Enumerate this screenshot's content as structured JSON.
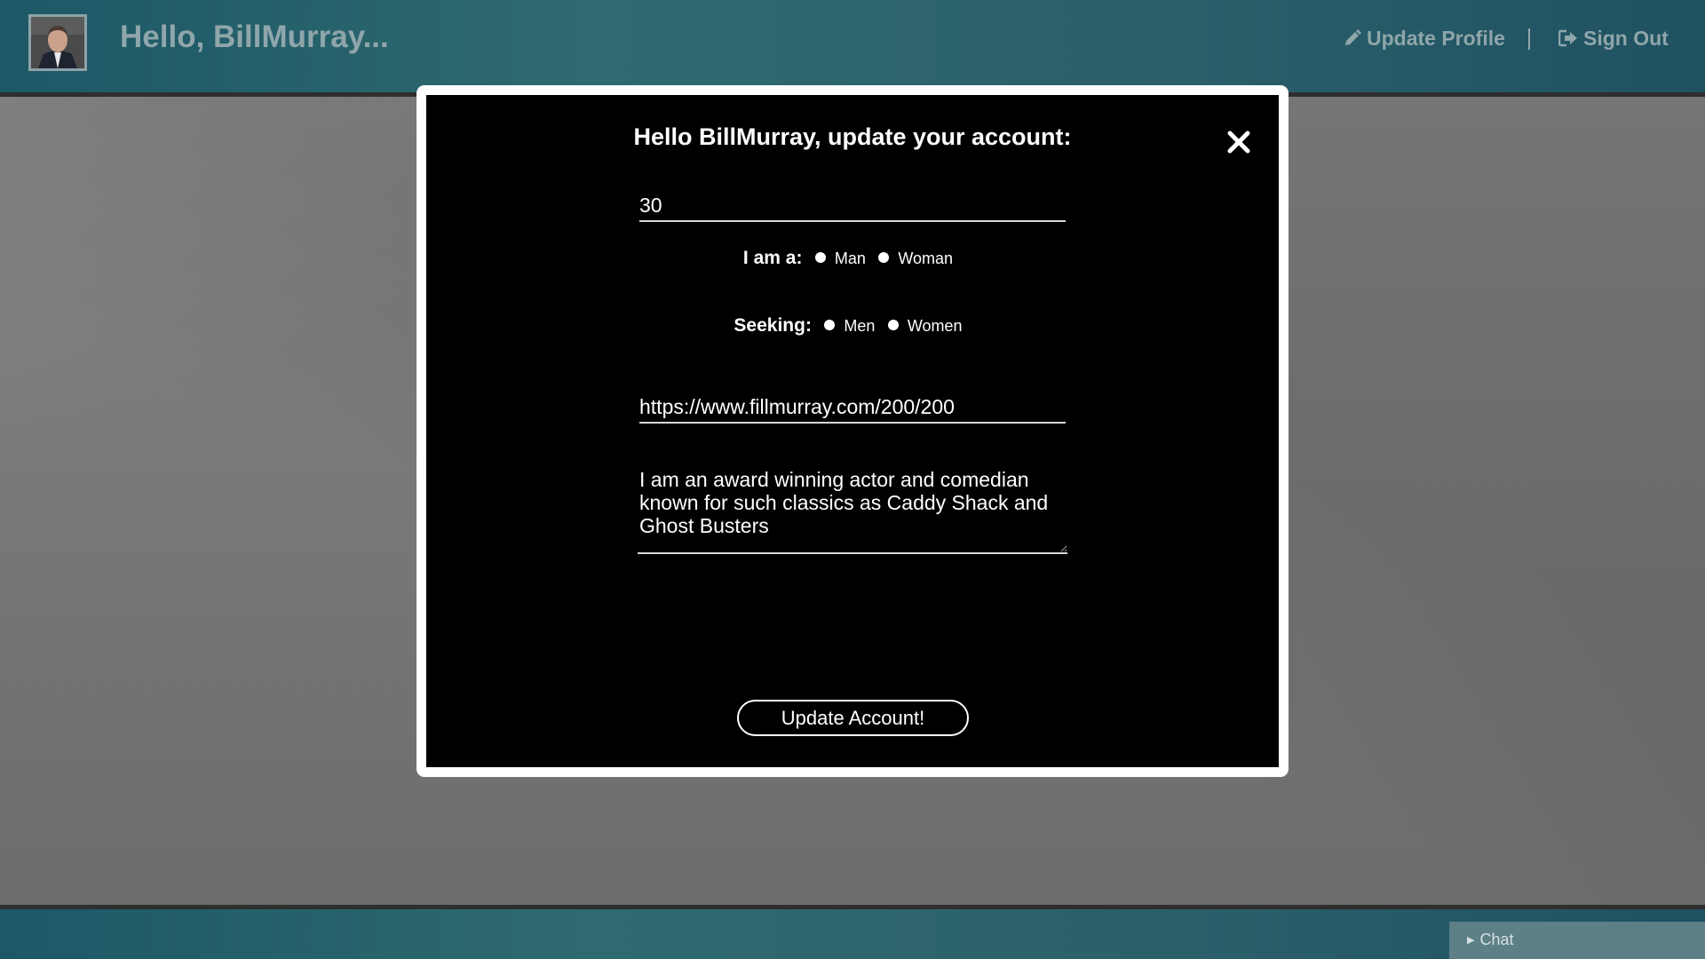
{
  "header": {
    "greeting": "Hello, BillMurray...",
    "update_profile_label": "Update Profile",
    "sign_out_label": "Sign Out",
    "separator": "|",
    "text_color": "#8fa6aa",
    "bar_color": "#2f6a70"
  },
  "modal": {
    "title": "Hello BillMurray, update your account:",
    "age_value": "30",
    "gender": {
      "label": "I am a:",
      "options": [
        "Man",
        "Woman"
      ]
    },
    "seeking": {
      "label": "Seeking:",
      "options": [
        "Men",
        "Women"
      ]
    },
    "photo_url_value": "https://www.fillmurray.com/200/200",
    "bio_value": "I am an award winning actor and comedian known for such classics as Caddy Shack and Ghost Busters",
    "submit_label": "Update Account!",
    "close_icon": "close-icon"
  },
  "footer": {
    "chat_label": "Chat"
  },
  "icons": {
    "update_profile": "pencil-icon",
    "sign_out": "sign-out-icon",
    "chat": "caret-right-icon"
  }
}
